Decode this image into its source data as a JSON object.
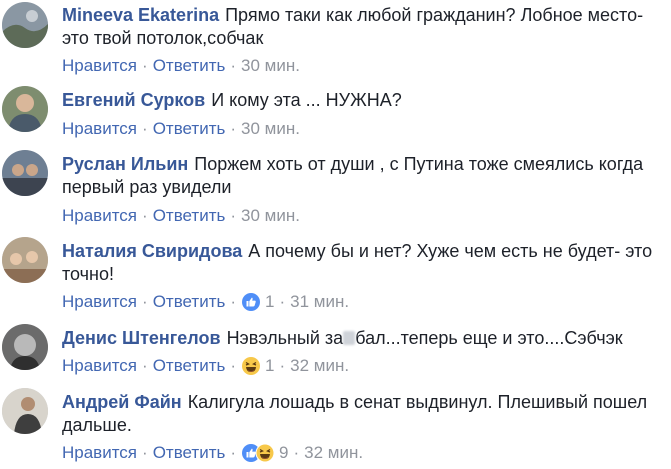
{
  "colors": {
    "author": "#385898",
    "link": "#4267b2",
    "meta": "#90949c",
    "text": "#1d2129"
  },
  "actions": {
    "like": "Нравится",
    "reply": "Ответить",
    "sep": "·"
  },
  "comments": [
    {
      "author": "Mineeva Ekaterina",
      "text_line1": "Прямо таки как любой гражданин? Лобное место-",
      "text_line2": "это твой потолок,собчак",
      "time": "30 мин."
    },
    {
      "author": "Евгений Сурков",
      "text_line1": "И кому эта ... НУЖНА?",
      "time": "30 мин."
    },
    {
      "author": "Руслан Ильин",
      "text_line1": "Поржем хоть от души , с Путина тоже смеялись когда",
      "text_line2": "первый раз увидели",
      "time": "30 мин."
    },
    {
      "author": "Наталия Свиридова",
      "text_line1": "А почему бы и нет? Хуже чем есть не будет- это",
      "text_line2": "точно!",
      "reactions": "like",
      "count": "1",
      "time": "31 мин."
    },
    {
      "author": "Денис Штенгелов",
      "text_pre": "Нэвэльный за",
      "text_post": "бал...теперь еще и это....Сэбчэк",
      "reactions": "haha",
      "count": "1",
      "time": "32 мин."
    },
    {
      "author": "Андрей Файн",
      "text_line1": "Калигула лошадь в сенат выдвинул. Плешивый пошел",
      "text_line2": "дальше.",
      "reactions": "like+haha",
      "count": "9",
      "time": "32 мин."
    }
  ]
}
